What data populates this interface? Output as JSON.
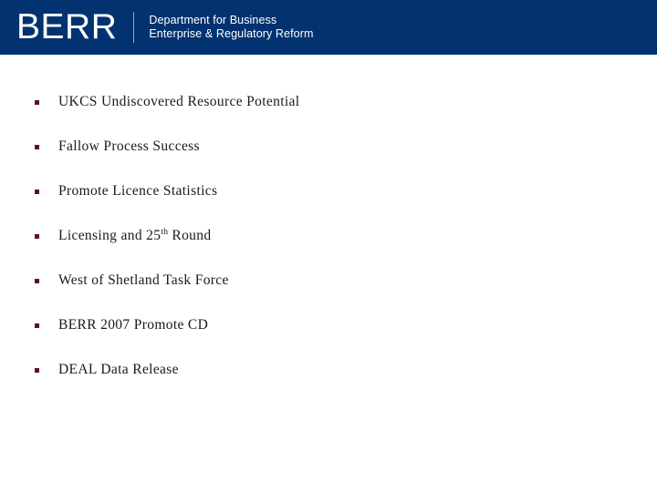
{
  "header": {
    "brand": "BERR",
    "department_line1": "Department for Business",
    "department_line2": "Enterprise & Regulatory Reform",
    "background_color": "#023270",
    "text_color": "#ffffff",
    "divider_color": "#8fa8c6"
  },
  "content": {
    "bullet_color": "#5C1030",
    "text_color": "#1a1a1a",
    "background_color": "#ffffff",
    "bullets": [
      {
        "text": "UKCS Undiscovered Resource Potential"
      },
      {
        "text": "Fallow Process Success"
      },
      {
        "text": "Promote Licence Statistics"
      },
      {
        "text_before": "Licensing and 25",
        "superscript": "th",
        "text_after": " Round"
      },
      {
        "text": "West of Shetland Task Force"
      },
      {
        "text": "BERR 2007 Promote CD"
      },
      {
        "text": "DEAL Data Release"
      }
    ]
  }
}
